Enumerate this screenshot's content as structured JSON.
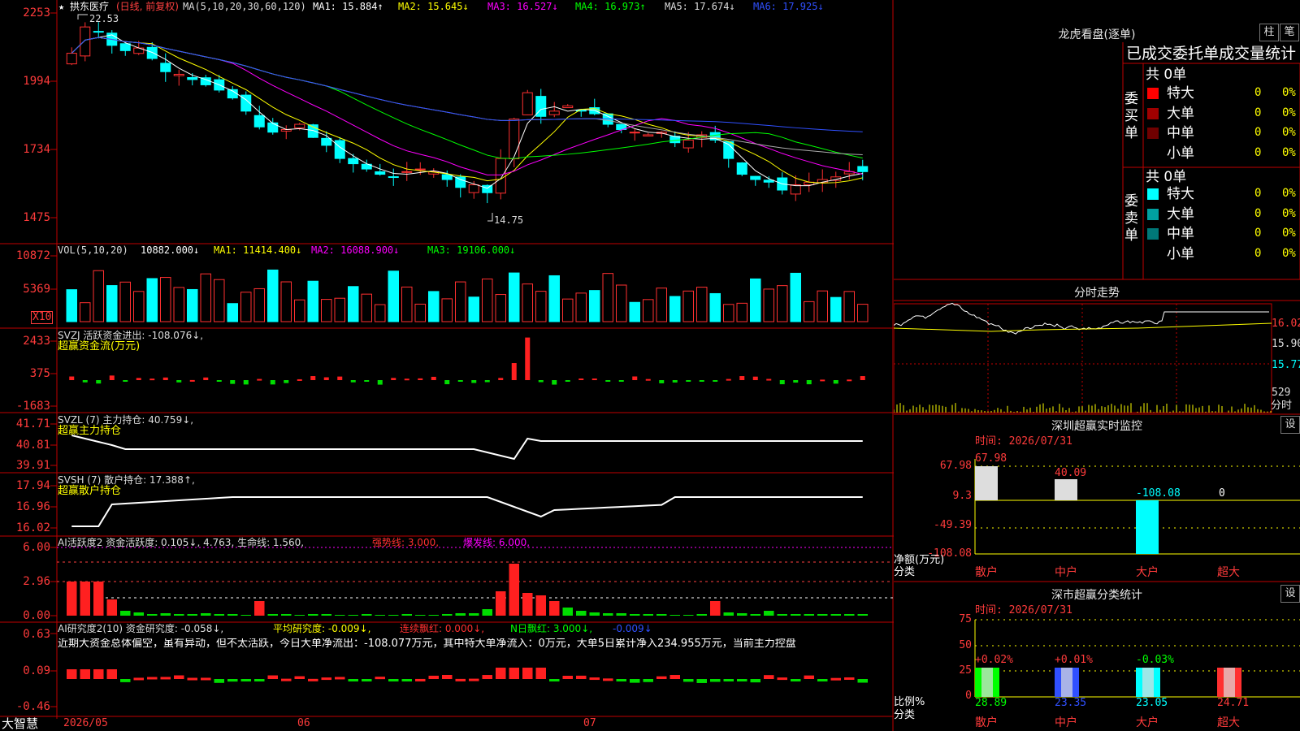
{
  "stock": {
    "name": "拱东医疗",
    "period": "(日线, 前复权)",
    "ma_label": "MA(5,10,20,30,60,120)",
    "ma1": "MA1: 15.884↑",
    "ma2": "MA2: 15.645↓",
    "ma3": "MA3: 16.527↓",
    "ma4": "MA4: 16.973↑",
    "ma5": "MA5: 17.674↓",
    "ma6": "MA6: 17.925↓",
    "high_label": "22.53",
    "low_label": "14.75",
    "price_axis": [
      "2253",
      "1994",
      "1734",
      "1475"
    ]
  },
  "vol_panel": {
    "label": "VOL(5,10,20)",
    "value": "10882.000↓",
    "ma1": "MA1: 11414.400↓",
    "ma2": "MA2: 16088.900↓",
    "ma3": "MA3: 19106.000↓",
    "axis": [
      "10872",
      "5369"
    ],
    "unit": "X10"
  },
  "svzj_panel": {
    "label": "SVZJ  活跃资金进出: -108.076↓,",
    "sub": "超赢资金流(万元)",
    "axis": [
      "2433",
      "375",
      "-1683"
    ]
  },
  "svzl_panel": {
    "label": "SVZL (7) 主力持仓: 40.759↓,",
    "sub": "超赢主力持仓",
    "axis": [
      "41.71",
      "40.81",
      "39.91"
    ]
  },
  "svsh_panel": {
    "label": "SVSH (7) 散户持仓: 17.388↑,",
    "sub": "超赢散户持仓",
    "axis": [
      "17.94",
      "16.96",
      "16.02"
    ]
  },
  "ai_active_panel": {
    "label": "AI活跃度2 资金活跃度: 0.105↓, 4.763, 生命线: 1.560,",
    "strong": "强势线: 3.000,",
    "burst": "爆发线: 6.000,",
    "axis": [
      "6.00",
      "2.96",
      "0.00"
    ]
  },
  "ai_research_panel": {
    "label": "AI研究度2(10) 资金研究度: -0.058↓,",
    "avg": "平均研究度: -0.009↓,",
    "cont": "连续飘红: 0.000↓,",
    "nday": "N日飘红: 3.000↓,",
    "last": "-0.009↓",
    "commentary": "近期大资金总体偏空，虽有异动，但不太活跃，今日大单净流出：-108.077万元，其中特大单净流入：0万元，大单5日累计净入234.955万元，当前主力控盘",
    "axis": [
      "0.63",
      "0.09",
      "-0.46"
    ]
  },
  "date_axis": {
    "brand": "大智慧",
    "labels": [
      "2026/05",
      "06",
      "07"
    ]
  },
  "right": {
    "dragon": {
      "title": "龙虎看盘(逐单)",
      "btn1": "柱",
      "btn2": "笔",
      "stats_title": "已成交委托单成交量统计",
      "buy": {
        "side": "委买单",
        "total": "共 0单",
        "rows": [
          {
            "name": "特大",
            "count": "0",
            "pct": "0%",
            "color": "#ff0000"
          },
          {
            "name": "大单",
            "count": "0",
            "pct": "0%",
            "color": "#a00000"
          },
          {
            "name": "中单",
            "count": "0",
            "pct": "0%",
            "color": "#700000"
          },
          {
            "name": "小单",
            "count": "0",
            "pct": "0%",
            "color": ""
          }
        ]
      },
      "sell": {
        "side": "委卖单",
        "total": "共 0单",
        "rows": [
          {
            "name": "特大",
            "count": "0",
            "pct": "0%",
            "color": "#00ffff"
          },
          {
            "name": "大单",
            "count": "0",
            "pct": "0%",
            "color": "#00a0a0"
          },
          {
            "name": "中单",
            "count": "0",
            "pct": "0%",
            "color": "#007878"
          },
          {
            "name": "小单",
            "count": "0",
            "pct": "0%",
            "color": ""
          }
        ]
      }
    },
    "intraday": {
      "title": "分时走势",
      "axis": [
        "16.02",
        "15.90",
        "15.77"
      ],
      "vol": "529",
      "vol_unit": "分时"
    },
    "monitor": {
      "title": "深圳超赢实时监控",
      "btn": "设",
      "time": "时间: 2026/07/31",
      "axis": [
        "67.98",
        "9.3",
        "-49.39",
        "-108.08"
      ],
      "ylabel": "净额(万元)",
      "xlabel": "分类",
      "cats": [
        "散户",
        "中户",
        "大户",
        "超大"
      ],
      "values": [
        "67.98",
        "40.09",
        "-108.08",
        "0"
      ]
    },
    "classify": {
      "title": "深市超赢分类统计",
      "btn": "设",
      "time": "时间: 2026/07/31",
      "axis": [
        "75",
        "50",
        "25",
        "0"
      ],
      "ylabel": "比例%",
      "xlabel": "分类",
      "cats": [
        "散户",
        "中户",
        "大户",
        "超大"
      ],
      "top": [
        "+0.02%",
        "+0.01%",
        "-0.03%",
        ""
      ],
      "bottom": [
        "28.89",
        "23.35",
        "23.05",
        "24.71"
      ]
    }
  }
}
